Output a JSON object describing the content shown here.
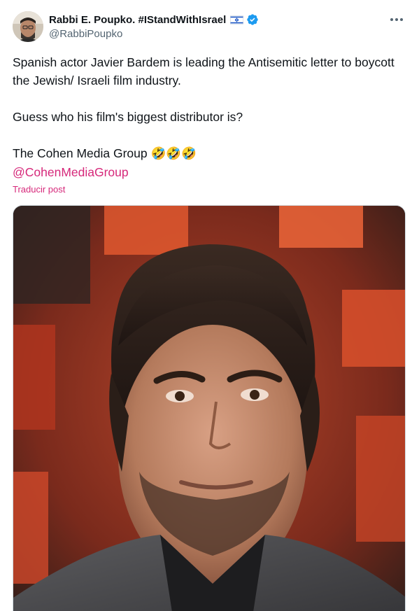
{
  "author": {
    "display_name": "Rabbi E. Poupko. #IStandWithIsrael",
    "handle": "@RabbiPoupko",
    "flag_icon": "israel-flag-icon",
    "verified_icon": "verified-badge-icon",
    "verified_color": "#1d9bf0"
  },
  "menu": {
    "more_icon": "more-options-icon"
  },
  "tweet": {
    "line1": "Spanish actor Javier Bardem is leading the Antisemitic letter to boycott the Jewish/ Israeli film industry.",
    "line2": "Guess who his film's biggest distributor is?",
    "line3_text": "The Cohen Media Group ",
    "line3_emoji": "🤣🤣🤣",
    "mention": "@CohenMediaGroup",
    "mention_color": "#d6287a"
  },
  "translate_link": "Traducir post",
  "media": {
    "type": "photo"
  }
}
